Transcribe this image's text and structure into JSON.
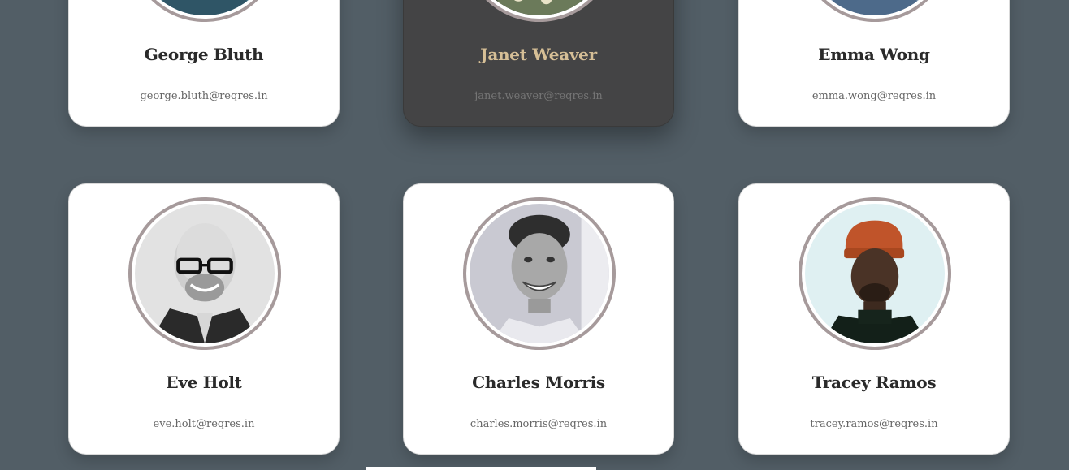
{
  "users": [
    {
      "name": "George Bluth",
      "email": "george.bluth@reqres.in",
      "avatar": "george-photo"
    },
    {
      "name": "Janet Weaver",
      "email": "janet.weaver@reqres.in",
      "avatar": "janet-photo",
      "highlighted": true
    },
    {
      "name": "Emma Wong",
      "email": "emma.wong@reqres.in",
      "avatar": "emma-photo"
    },
    {
      "name": "Eve Holt",
      "email": "eve.holt@reqres.in",
      "avatar": "eve-photo"
    },
    {
      "name": "Charles Morris",
      "email": "charles.morris@reqres.in",
      "avatar": "charles-photo"
    },
    {
      "name": "Tracey Ramos",
      "email": "tracey.ramos@reqres.in",
      "avatar": "tracey-photo"
    }
  ],
  "colors": {
    "background": "#525e66",
    "card": "#ffffff",
    "card_highlight": "#444445",
    "name_highlight": "#d6bf96",
    "avatar_ring": "#a69a9b"
  }
}
